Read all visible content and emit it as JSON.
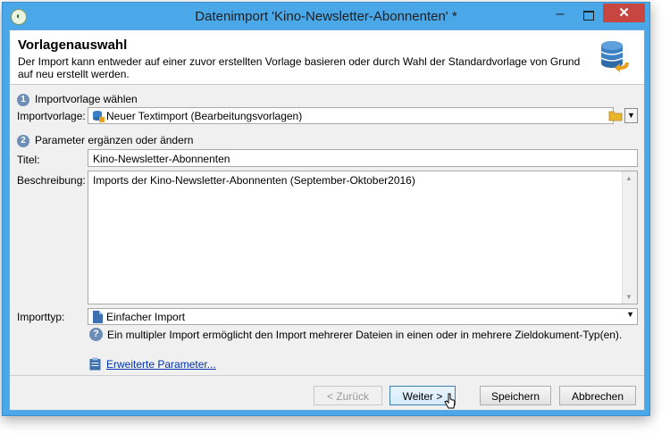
{
  "window": {
    "title": "Datenimport 'Kino-Newsletter-Abonnenten' *",
    "minimize": "–",
    "close": "✕"
  },
  "header": {
    "title": "Vorlagenauswahl",
    "description": "Der Import kann entweder auf einer zuvor erstellten Vorlage basieren oder durch Wahl der Standardvorlage von Grund auf neu erstellt werden."
  },
  "step1": {
    "number": "1",
    "label": "Importvorlage wählen"
  },
  "template": {
    "label": "Importvorlage:",
    "value": "Neuer Textimport (Bearbeitungsvorlagen)"
  },
  "step2": {
    "number": "2",
    "label": "Parameter ergänzen oder ändern"
  },
  "titel": {
    "label": "Titel:",
    "value": "Kino-Newsletter-Abonnenten"
  },
  "beschreibung": {
    "label": "Beschreibung:",
    "value": "Imports der Kino-Newsletter-Abonnenten (September-Oktober2016)"
  },
  "importtyp": {
    "label": "Importtyp:",
    "value": "Einfacher Import"
  },
  "help_text": "Ein multipler Import ermöglicht den Import mehrerer Dateien in einen oder in mehrere Zieldokument-Typ(en).",
  "advanced_link": "Erweiterte Parameter...",
  "buttons": {
    "back": "< Zurück",
    "next": "Weiter >",
    "save": "Speichern",
    "cancel": "Abbrechen"
  },
  "colors": {
    "titlebar": "#4aa8e8",
    "close": "#c7463f",
    "link": "#0033aa"
  }
}
